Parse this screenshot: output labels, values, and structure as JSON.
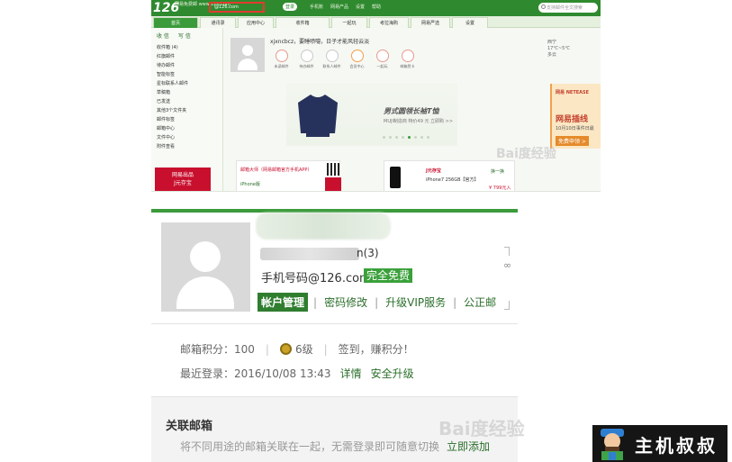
{
  "top_screenshot": {
    "logo": "126",
    "logo_sub": "网易免费邮 www.126.com",
    "account": "@126.com",
    "vip_label": "登录",
    "top_menu": [
      "手机账",
      "网易产品",
      "设置",
      "帮助"
    ],
    "search_placeholder": "支持邮件全文搜索",
    "tabs": [
      "首页",
      "通讯录",
      "应用中心",
      "收件箱",
      "一起玩",
      "考拉海购",
      "网易严选",
      "设置"
    ],
    "write_buttons": [
      "收 信",
      "写 信"
    ],
    "folders": [
      "收件箱 (4)",
      "红旗邮件",
      "待办邮件",
      "智能标签",
      "星标联系人邮件",
      "草稿箱",
      "已发送",
      "其他3个文件夹",
      "邮件标签",
      "邮箱中心",
      "文件中心",
      "附件查看"
    ],
    "promo_text": [
      "网易出品",
      "J元存宝"
    ],
    "greeting": "xjxncbcz，要睡喷嚏，日子才能风轻云淡",
    "shortcut_labels": [
      "未读邮件",
      "待办邮件",
      "联系人邮件",
      "会员中心",
      "一起玩",
      "邮箱贺卡"
    ],
    "banner_title": "男式圆领长袖T恤",
    "banner_sub": "MUJI制造商 特价49 元 立即购 >>",
    "weather": [
      "西宁",
      "17℃~5℃",
      "多云"
    ],
    "right_ad": {
      "title": "网易 NETEASE",
      "main": "网易插线",
      "date": "10月10日事件日最",
      "button": "免费申领 >"
    },
    "qr_title": "邮箱大师（网易邮箱官方手机APP）",
    "qr_sub": "iPhone版",
    "product_shop": "J元存宝",
    "product_name": "iPhone7 256GB【官方】",
    "product_ext": "换一换",
    "product_price": "¥ 799元入手"
  },
  "account_panel": {
    "account_suffix": "n(3)",
    "email": "手机号码@126.com",
    "free_badge": "完全免费",
    "links": [
      {
        "label": "帐户管理",
        "active": true
      },
      {
        "label": "密码修改",
        "active": false
      },
      {
        "label": "升级VIP服务",
        "active": false
      },
      {
        "label": "公正邮",
        "active": false
      }
    ],
    "points_label": "邮箱积分：100",
    "level": "6级",
    "signin": "签到，赚积分！",
    "last_login": "最近登录：2016/10/08 13:43",
    "details_link": "详情",
    "security_link": "安全升级",
    "related_title": "关联邮箱",
    "related_desc": "将不同用途的邮箱关联在一起，无需登录即可随意切换",
    "related_link": "立即添加"
  },
  "watermark": "Bai度经验",
  "brand": "主机叔叔"
}
